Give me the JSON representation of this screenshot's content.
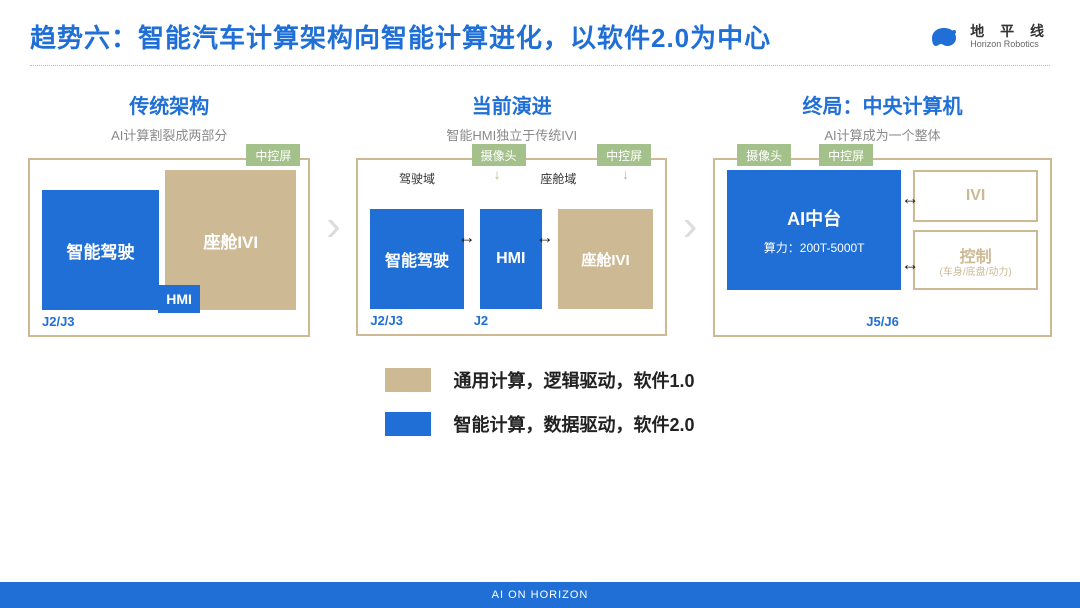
{
  "title": "趋势六：智能汽车计算架构向智能计算进化，以软件2.0为中心",
  "brand": {
    "cn": "地 平 线",
    "en": "Horizon Robotics"
  },
  "columns": {
    "c1": {
      "title": "传统架构",
      "sub": "AI计算割裂成两部分",
      "drive": "智能驾驶",
      "ivi": "座舱IVI",
      "ctrl": "中控屏",
      "hmi": "HMI",
      "chip": "J2/J3"
    },
    "c2": {
      "title": "当前演进",
      "sub": "智能HMI独立于传统IVI",
      "domain_drive": "驾驶域",
      "domain_cockpit": "座舱域",
      "drive": "智能驾驶",
      "hmi": "HMI",
      "ivi": "座舱IVI",
      "cam": "摄像头",
      "ctrl": "中控屏",
      "chip1": "J2/J3",
      "chip2": "J2"
    },
    "c3": {
      "title": "终局：中央计算机",
      "sub": "AI计算成为一个整体",
      "ai_line1": "AI中台",
      "ai_line2": "算力：200T-5000T",
      "ivi": "IVI",
      "ctrl_l1": "控制",
      "ctrl_l2": "(车身/底盘/动力)",
      "cam": "摄像头",
      "scr": "中控屏",
      "chip": "J5/J6"
    }
  },
  "legend": {
    "tan": "通用计算，逻辑驱动，软件1.0",
    "blue": "智能计算，数据驱动，软件2.0"
  },
  "footer": "AI ON HORIZON"
}
